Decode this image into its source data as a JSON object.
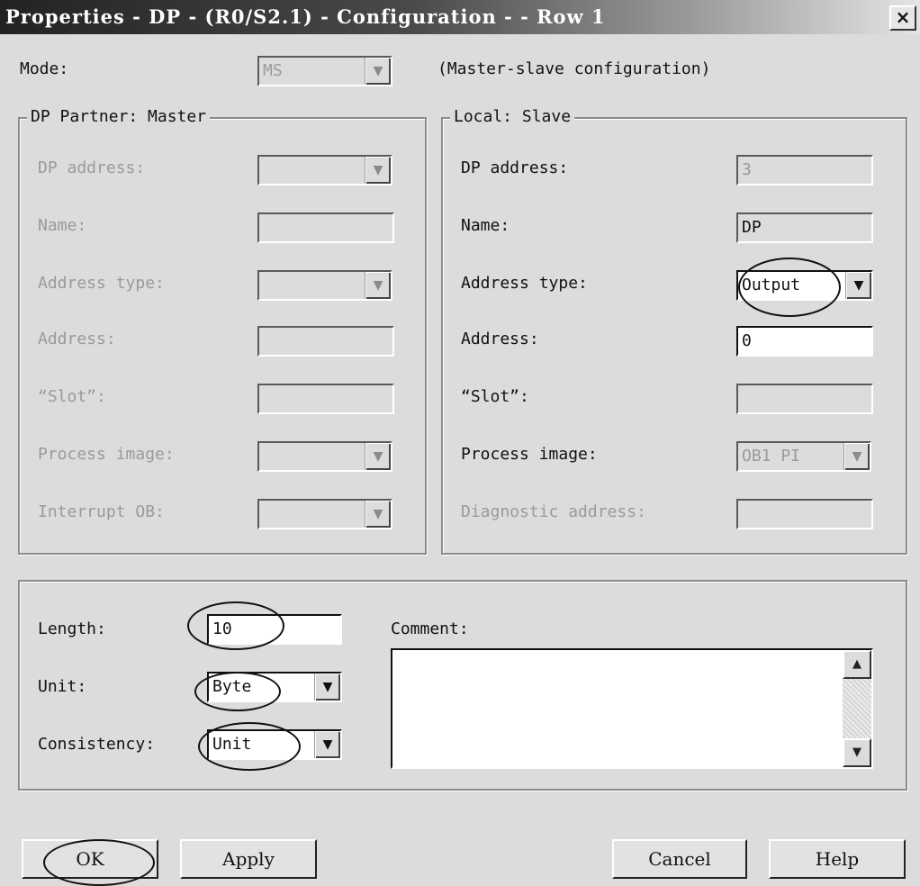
{
  "window": {
    "title": "Properties - DP - (R0/S2.1) - Configuration - - Row 1",
    "close": "×"
  },
  "mode": {
    "label": "Mode:",
    "value": "MS",
    "description": "(Master-slave configuration)"
  },
  "dp_partner": {
    "legend": "DP Partner: Master",
    "dp_address_label": "DP address:",
    "name_label": "Name:",
    "address_type_label": "Address type:",
    "address_label": "Address:",
    "slot_label": "“Slot”:",
    "process_image_label": "Process image:",
    "interrupt_ob_label": "Interrupt OB:"
  },
  "local": {
    "legend": "Local: Slave",
    "dp_address_label": "DP address:",
    "dp_address_value": "3",
    "name_label": "Name:",
    "name_value": "DP",
    "address_type_label": "Address type:",
    "address_type_value": "Output",
    "address_label": "Address:",
    "address_value": "0",
    "slot_label": "“Slot”:",
    "slot_value": "",
    "process_image_label": "Process image:",
    "process_image_value": "OB1 PI",
    "diagnostic_address_label": "Diagnostic address:",
    "diagnostic_address_value": ""
  },
  "bottom": {
    "length_label": "Length:",
    "length_value": "10",
    "unit_label": "Unit:",
    "unit_value": "Byte",
    "consistency_label": "Consistency:",
    "consistency_value": "Unit",
    "comment_label": "Comment:",
    "comment_value": ""
  },
  "buttons": {
    "ok": "OK",
    "apply": "Apply",
    "cancel": "Cancel",
    "help": "Help"
  },
  "icons": {
    "dropdown": "▼",
    "scroll_up": "▲",
    "scroll_down": "▼"
  }
}
